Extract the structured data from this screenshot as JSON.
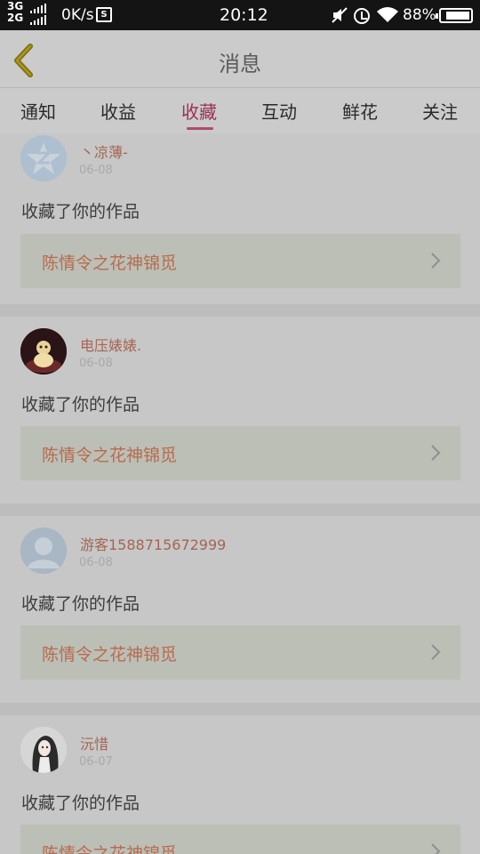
{
  "status_bar": {
    "network_top": "3G",
    "network_bottom": "2G",
    "speed": "0K/s",
    "storage_icon_letter": "S",
    "time": "20:12",
    "battery_percent": "88%",
    "battery_level": 0.88
  },
  "header": {
    "title": "消息",
    "back_icon": "chevron-left-icon"
  },
  "tabs": [
    {
      "label": "通知",
      "active": false
    },
    {
      "label": "收益",
      "active": false
    },
    {
      "label": "收藏",
      "active": true
    },
    {
      "label": "互动",
      "active": false
    },
    {
      "label": "鲜花",
      "active": false
    },
    {
      "label": "关注",
      "active": false
    }
  ],
  "messages": [
    {
      "username": "丶凉薄-",
      "date": "06-08",
      "action": "收藏了你的作品",
      "work_title": "陈情令之花神锦觅",
      "avatar": "default-qq-avatar"
    },
    {
      "username": "电压婊婊.",
      "date": "06-08",
      "action": "收藏了你的作品",
      "work_title": "陈情令之花神锦觅",
      "avatar": "toy-photo-avatar"
    },
    {
      "username": "游客1588715672999",
      "date": "06-08",
      "action": "收藏了你的作品",
      "work_title": "陈情令之花神锦觅",
      "avatar": "default-guest-avatar"
    },
    {
      "username": "沅惜",
      "date": "06-07",
      "action": "收藏了你的作品",
      "work_title": "陈情令之花神锦觅",
      "avatar": "anime-girl-avatar"
    }
  ],
  "colors": {
    "accent": "#9b3155",
    "username": "#a56552",
    "work_title": "#b76a4f"
  }
}
